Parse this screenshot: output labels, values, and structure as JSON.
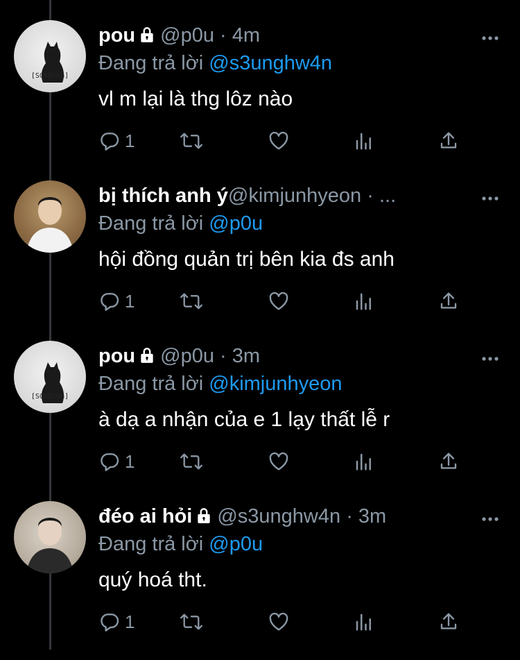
{
  "tweets": [
    {
      "avatar": "cat-avatar",
      "avatar_label": "[SOBBING]",
      "name": "pou",
      "handle": "@p0u",
      "sep": "·",
      "time": "4m",
      "locked": true,
      "reply_prefix": "Đang trả lời",
      "reply_to": "@s3unghw4n",
      "text": "vl m lại là thg lôz nào",
      "reply_count": "1"
    },
    {
      "avatar": "photo-avatar",
      "avatar_label": "",
      "name": "bị thích anh ý",
      "handle": "@kimjunhyeon",
      "sep": "·",
      "time": "...",
      "locked": false,
      "reply_prefix": "Đang trả lời",
      "reply_to": "@p0u",
      "text": "hội đồng quản trị bên kia đs anh",
      "reply_count": "1"
    },
    {
      "avatar": "cat-avatar",
      "avatar_label": "[SOBBING]",
      "name": "pou",
      "handle": "@p0u",
      "sep": "·",
      "time": "3m",
      "locked": true,
      "reply_prefix": "Đang trả lời",
      "reply_to": "@kimjunhyeon",
      "text": "à dạ a nhận của e 1 lạy thất lễ r",
      "reply_count": "1"
    },
    {
      "avatar": "photo-avatar",
      "avatar_label": "",
      "name": "đéo ai hỏi",
      "handle": "@s3unghw4n",
      "sep": "·",
      "time": "3m",
      "locked": true,
      "reply_prefix": "Đang trả lời",
      "reply_to": "@p0u",
      "text": "quý hoá tht.",
      "reply_count": "1"
    }
  ],
  "colors": {
    "background": "#000000",
    "muted": "#8b98a5",
    "link": "#1d9bf0",
    "text": "#ffffff"
  },
  "icons": [
    "more-icon",
    "reply-icon",
    "retweet-icon",
    "like-icon",
    "analytics-icon",
    "share-icon",
    "lock-icon"
  ]
}
